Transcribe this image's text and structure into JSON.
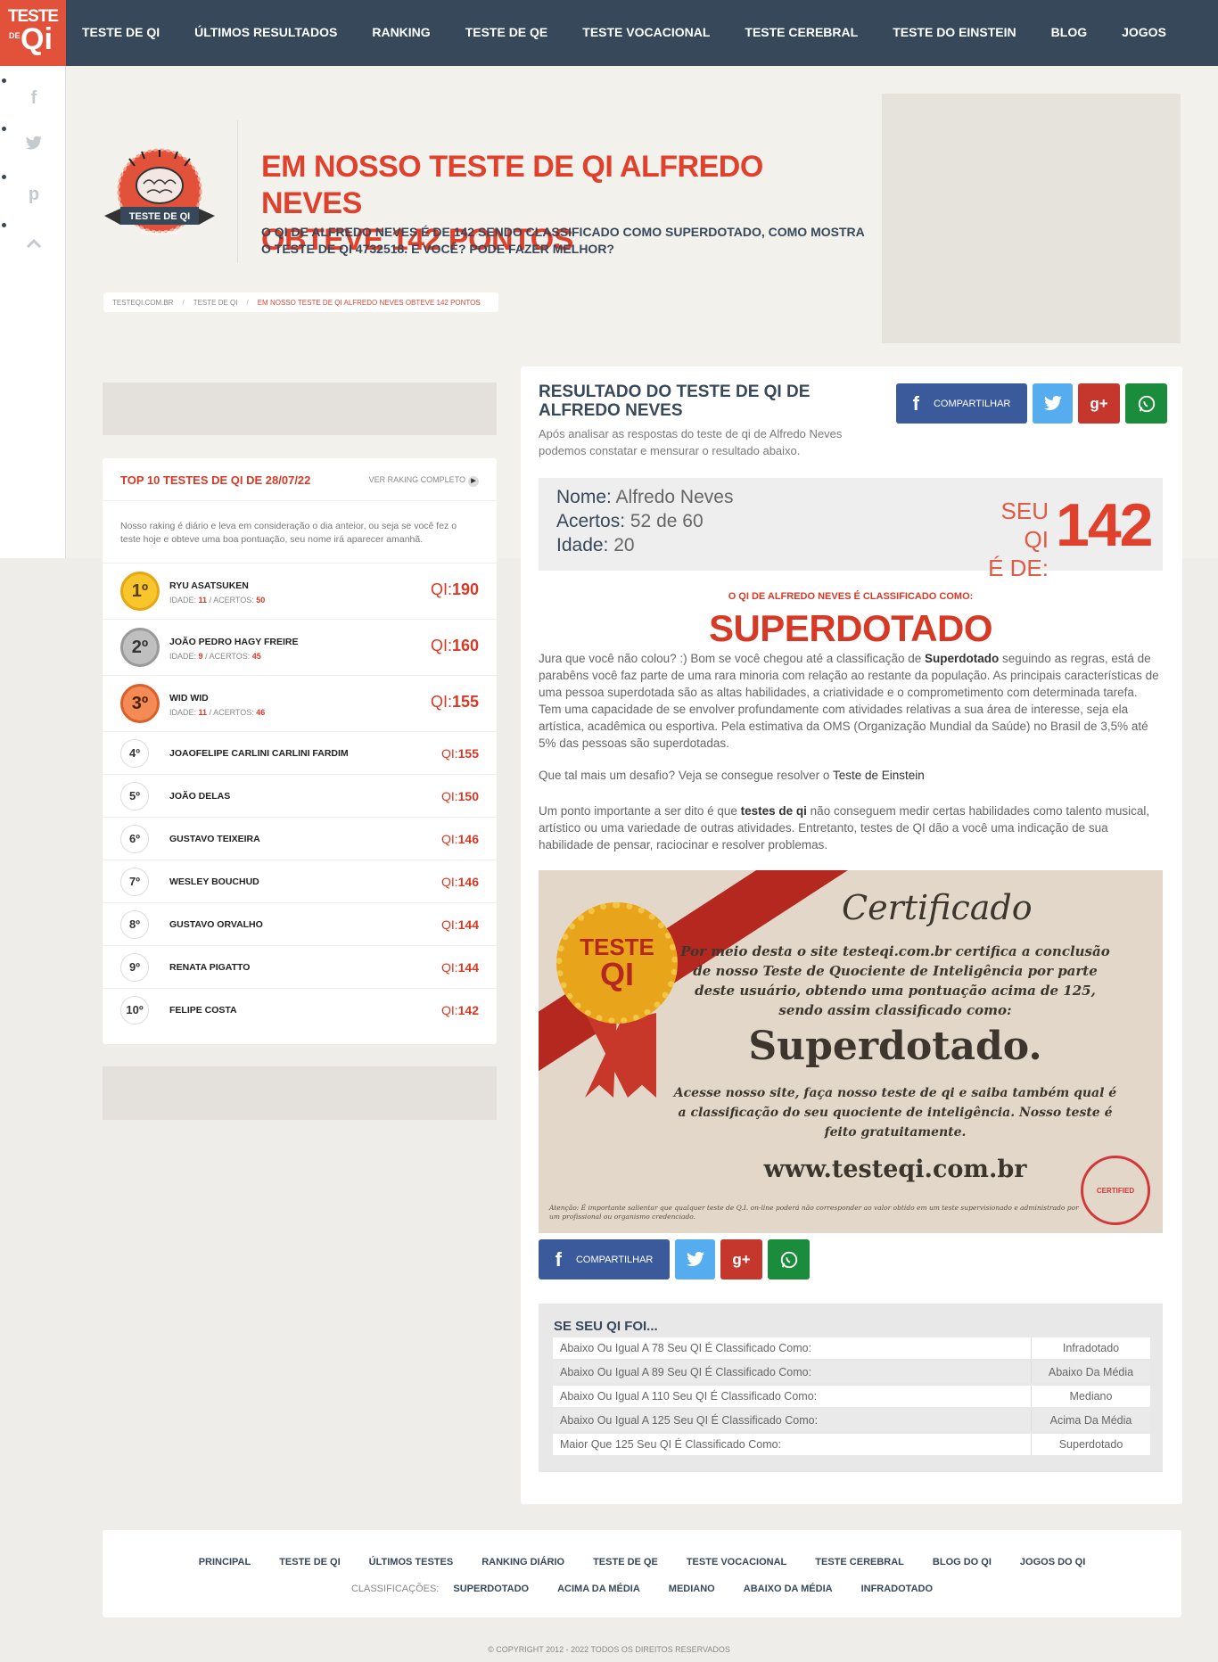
{
  "logo": {
    "line1": "TESTE",
    "line2": "DE",
    "line3": "Qi"
  },
  "nav": [
    "TESTE DE QI",
    "ÚLTIMOS RESULTADOS",
    "RANKING",
    "TESTE DE QE",
    "TESTE VOCACIONAL",
    "TESTE CEREBRAL",
    "TESTE DO EINSTEIN",
    "BLOG",
    "JOGOS"
  ],
  "social_side": {
    "icons": [
      "facebook-icon",
      "twitter-icon",
      "pinterest-icon",
      "chevron-up-icon"
    ]
  },
  "badge": {
    "text": "TESTE DE QI",
    "small": "TESTEQI.COM.BR"
  },
  "hero": {
    "title_line1": "EM NOSSO TESTE DE QI ALFREDO NEVES",
    "title_line2": "OBTEVE 142 PONTOS",
    "subtitle": "O QI DE ALFREDO NEVES É DE 142 SENDO CLASSIFICADO COMO SUPERDOTADO, COMO MOSTRA O TESTE DE QI 4732518. E VOCÊ? PODE FAZER MELHOR?"
  },
  "breadcrumb": [
    "TESTEQI.COM.BR",
    "TESTE DE QI",
    "EM NOSSO TESTE DE QI ALFREDO NEVES OBTEVE 142 PONTOS"
  ],
  "breadcrumb_sep": "/",
  "ranking": {
    "title": "TOP 10 TESTES DE QI DE 28/07/22",
    "link": "VER RAKING COMPLETO",
    "desc": "Nosso raking é diário e leva em consideração o dia anteior, ou seja se você fez o teste hoje e obteve uma boa pontuação, seu nome irá aparecer amanhã.",
    "qi_label": "QI:",
    "age_label": "IDADE:",
    "hits_label": "/ ACERTOS:",
    "top": [
      {
        "pos": "1º",
        "name": "RYU ASATSUKEN",
        "age": "11",
        "hits": "50",
        "qi": "190"
      },
      {
        "pos": "2º",
        "name": "JOÃO PEDRO HAGY FREIRE",
        "age": "9",
        "hits": "45",
        "qi": "160"
      },
      {
        "pos": "3º",
        "name": "WID WID",
        "age": "11",
        "hits": "46",
        "qi": "155"
      }
    ],
    "rest": [
      {
        "pos": "4º",
        "name": "JOAOFELIPE CARLINI CARLINI FARDIM",
        "qi": "155"
      },
      {
        "pos": "5º",
        "name": "JOÃO DELAS",
        "qi": "150"
      },
      {
        "pos": "6º",
        "name": "GUSTAVO TEIXEIRA",
        "qi": "146"
      },
      {
        "pos": "7º",
        "name": "WESLEY BOUCHUD",
        "qi": "146"
      },
      {
        "pos": "8º",
        "name": "GUSTAVO ORVALHO",
        "qi": "144"
      },
      {
        "pos": "9º",
        "name": "RENATA PIGATTO",
        "qi": "144"
      },
      {
        "pos": "10º",
        "name": "FELIPE COSTA",
        "qi": "142"
      }
    ]
  },
  "result": {
    "title": "RESULTADO DO TESTE DE QI DE ALFREDO NEVES",
    "sub": "Após analisar as respostas do teste de qi de Alfredo Neves podemos constatar e mensurar o resultado abaixo.",
    "share_label": "COMPARTILHAR",
    "share_glyphs": {
      "fb": "f",
      "tw": "t",
      "gp": "g+",
      "wa": "w"
    },
    "name_label": "Nome:",
    "name": "Alfredo Neves",
    "hits_label": "Acertos:",
    "hits": "52 de 60",
    "age_label": "Idade:",
    "age": "20",
    "seu_qi": "SEU QI",
    "e_de": "É DE:",
    "score": "142",
    "class_label": "O QI DE ALFREDO NEVES É CLASSIFICADO COMO:",
    "class_value": "SUPERDOTADO",
    "p1_a": "Jura que você não colou? :) Bom se você chegou até a classificação de ",
    "p1_b": "Superdotado",
    "p1_c": " seguindo as regras, está de parabêns você faz parte de uma rara minoria com relação ao restante da população. As principais características de uma pessoa superdotada são as altas habilidades, a criatividade e o comprometimento com determinada tarefa. Tem uma capacidade de se envolver profundamente com atividades relativas a sua área de interesse, seja ela artística, acadêmica ou esportiva. Pela estimativa da OMS (Organização Mundial da Saúde) no Brasil de 3,5% até 5% das pessoas são superdotadas.",
    "p2_a": "Que tal mais um desafio? Veja se consegue resolver o ",
    "p2_b": "Teste de Einstein",
    "p3_a": "Um ponto importante a ser dito é que ",
    "p3_b": "testes de qi",
    "p3_c": " não conseguem medir certas habilidades como talento musical, artístico ou uma variedade de outras atividades. Entretanto, testes de QI dão a você uma indicação de sua habilidade de pensar, raciocinar e resolver problemas."
  },
  "certificate": {
    "title": "Certificado",
    "body": "Por meio desta o site testeqi.com.br certifica a conclusão de nosso Teste de Quociente de Inteligência por parte deste usuário, obtendo uma pontuação acima de 125, sendo assim classificado como:",
    "class": "Superdotado.",
    "footer": "Acesse nosso site, faça nosso teste de qi e saiba também qual é a classificação do seu quociente de inteligência. Nosso teste é feito gratuitamente.",
    "url": "www.testeqi.com.br",
    "note": "Atenção: É importante salientar que qualquer teste de Q.I. on-line poderá não corresponder ao valor obtido em um teste supervisionado e administrado por um profissional ou organismo credenciado.",
    "seal1": "TESTE",
    "seal2": "QI",
    "stamp": "CERTIFIED"
  },
  "table": {
    "title": "SE SEU QI FOI...",
    "rows": [
      {
        "cond": "Abaixo Ou Igual A 78 Seu QI É Classificado Como:",
        "cls": "Infradotado"
      },
      {
        "cond": "Abaixo Ou Igual A 89 Seu QI É Classificado Como:",
        "cls": "Abaixo Da Média"
      },
      {
        "cond": "Abaixo Ou Igual A 110 Seu QI É Classificado Como:",
        "cls": "Mediano"
      },
      {
        "cond": "Abaixo Ou Igual A 125 Seu QI É Classificado Como:",
        "cls": "Acima Da Média"
      },
      {
        "cond": "Maior Que 125 Seu QI É Classificado Como:",
        "cls": "Superdotado"
      }
    ]
  },
  "footer": {
    "links": [
      "PRINCIPAL",
      "TESTE DE QI",
      "ÚLTIMOS TESTES",
      "RANKING DIÁRIO",
      "TESTE DE QE",
      "TESTE VOCACIONAL",
      "TESTE CEREBRAL",
      "BLOG DO QI",
      "JOGOS DO QI"
    ],
    "class_label": "CLASSIFICAÇÕES:",
    "classes": [
      "SUPERDOTADO",
      "ACIMA DA MÉDIA",
      "MEDIANO",
      "ABAIXO DA MÉDIA",
      "INFRADOTADO"
    ],
    "copyright": "© COPYRIGHT 2012 - 2022   TODOS OS DIREITOS RESERVADOS"
  },
  "colors": {
    "nav": "#36485a",
    "accent": "#e0412d",
    "facebook": "#3b5a9b",
    "twitter": "#55acee",
    "gplus": "#c5372c",
    "whatsapp": "#1b8c3c"
  }
}
